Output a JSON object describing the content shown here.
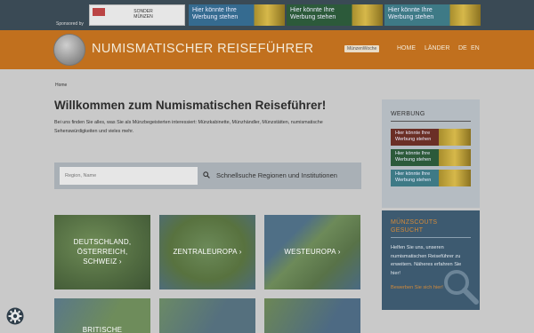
{
  "topbar": {
    "sponsored_label": "Sponsored by",
    "ad1_text": "SONDER\nMÜNZEN",
    "ad_text": "Hier könnte Ihre Werbung stehen"
  },
  "header": {
    "title": "NUMISMATISCHER REISEFÜHRER",
    "badge": "MünzenWoche",
    "nav": {
      "home": "HOME",
      "countries": "LÄNDER",
      "de": "DE",
      "en": "EN"
    }
  },
  "breadcrumb": "Home",
  "main": {
    "heading": "Willkommen zum Numismatischen Reiseführer!",
    "intro": "Bei uns finden Sie alles, was Sie als Münzbegeisterten interessiert: Münzkabinette, Münzhändler, Münzstätten, numismatische Sehenswürdigkeiten und vieles mehr."
  },
  "search": {
    "placeholder": "Region, Name",
    "label": "Schnellsuche Regionen und Institutionen"
  },
  "tiles": [
    {
      "label": "DEUTSCHLAND, ÖSTERREICH, SCHWEIZ"
    },
    {
      "label": "ZENTRALEUROPA"
    },
    {
      "label": "WESTEUROPA"
    },
    {
      "label": "BRITISCHE"
    }
  ],
  "sidebar": {
    "title": "WERBUNG",
    "ad_text": "Hier könnte Ihre Werbung stehen"
  },
  "scouts": {
    "title": "MÜNZSCOUTS GESUCHT",
    "text": "Helfen Sie uns, unseren numismatischen Reiseführer zu erweitern. Näheres erfahren Sie hier!",
    "link": "Bewerben Sie sich hier!"
  },
  "colors": {
    "header_bg": "#c1701e",
    "topbar_bg": "#3a4a55",
    "accent_orange": "#d38a3a",
    "scouts_bg": "#3d5a70"
  },
  "icons": [
    "search-icon",
    "chevron-right-icon",
    "gear-icon",
    "magnifier-icon",
    "coin-logo-icon",
    "flag-icon"
  ]
}
